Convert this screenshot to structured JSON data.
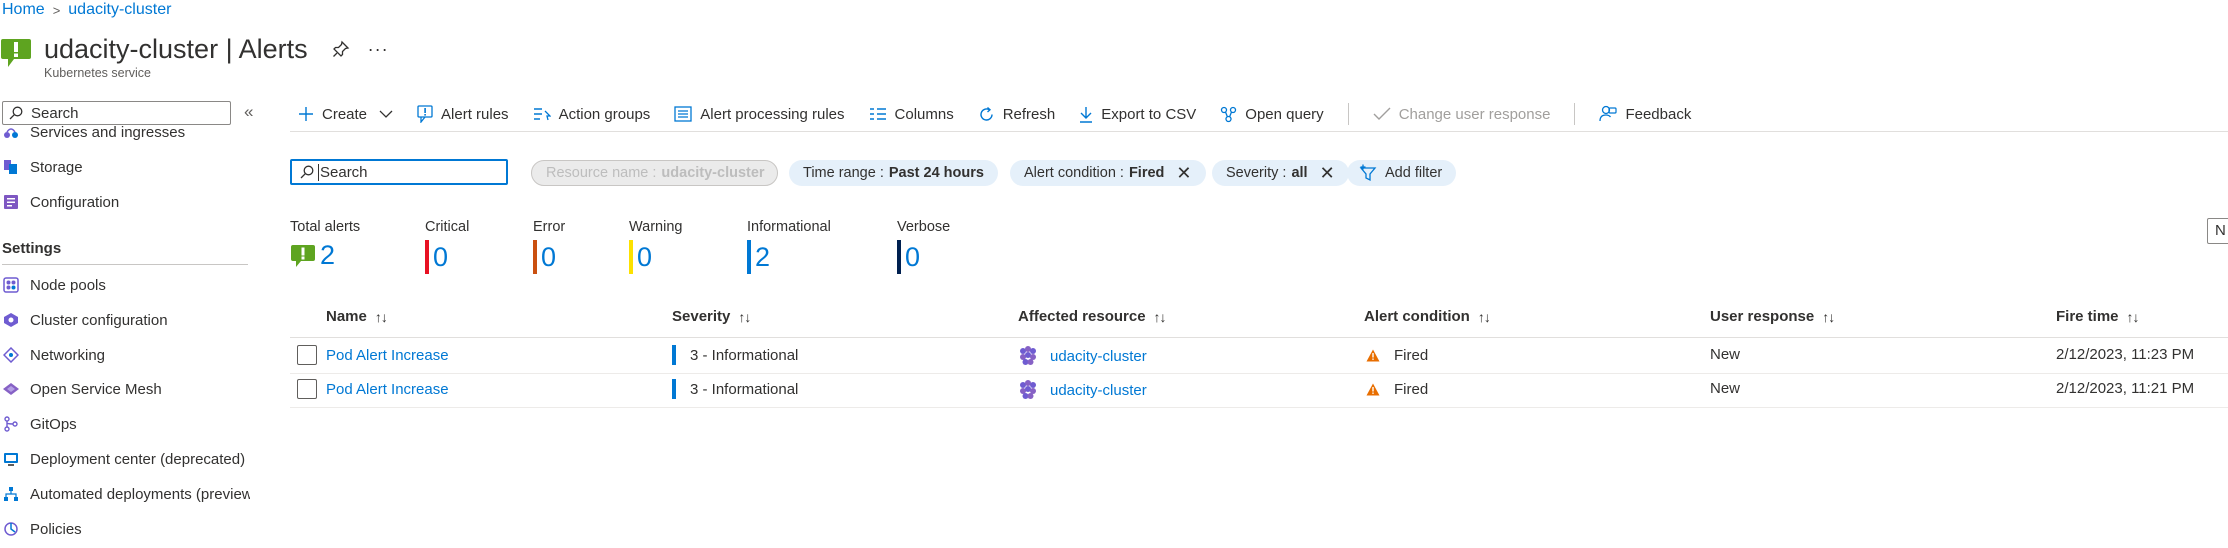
{
  "breadcrumb": {
    "home": "Home",
    "cluster": "udacity-cluster"
  },
  "header": {
    "title_prefix": "udacity-cluster",
    "title_sep": " | ",
    "title_page": "Alerts",
    "subtitle": "Kubernetes service"
  },
  "sidebar": {
    "search_placeholder": "Search",
    "items_top": [
      {
        "label": "Services and ingresses",
        "icon": "services-icon"
      },
      {
        "label": "Storage",
        "icon": "storage-icon"
      },
      {
        "label": "Configuration",
        "icon": "configuration-icon"
      }
    ],
    "settings_label": "Settings",
    "items_settings": [
      {
        "label": "Node pools",
        "icon": "node-pools-icon"
      },
      {
        "label": "Cluster configuration",
        "icon": "cluster-config-icon"
      },
      {
        "label": "Networking",
        "icon": "networking-icon"
      },
      {
        "label": "Open Service Mesh",
        "icon": "service-mesh-icon"
      },
      {
        "label": "GitOps",
        "icon": "gitops-icon"
      },
      {
        "label": "Deployment center (deprecated)",
        "icon": "deployment-center-icon"
      },
      {
        "label": "Automated deployments (preview)",
        "icon": "automated-deployments-icon"
      },
      {
        "label": "Policies",
        "icon": "policies-icon"
      }
    ]
  },
  "toolbar": {
    "create": "Create",
    "alert_rules": "Alert rules",
    "action_groups": "Action groups",
    "alert_processing_rules": "Alert processing rules",
    "columns": "Columns",
    "refresh": "Refresh",
    "export_csv": "Export to CSV",
    "open_query": "Open query",
    "change_user_response": "Change user response",
    "feedback": "Feedback"
  },
  "filters": {
    "search_value": "Search",
    "resource_name_label": "Resource name :",
    "resource_name_value": "udacity-cluster",
    "time_range_label": "Time range :",
    "time_range_value": "Past 24 hours",
    "alert_condition_label": "Alert condition :",
    "alert_condition_value": "Fired",
    "severity_label": "Severity :",
    "severity_value": "all",
    "add_filter": "Add filter"
  },
  "summary": {
    "total_label": "Total alerts",
    "total_value": "2",
    "critical_label": "Critical",
    "critical_value": "0",
    "error_label": "Error",
    "error_value": "0",
    "warning_label": "Warning",
    "warning_value": "0",
    "informational_label": "Informational",
    "informational_value": "2",
    "verbose_label": "Verbose",
    "verbose_value": "0",
    "right_stub": "N"
  },
  "colors": {
    "critical": "#e81123",
    "error": "#ca5010",
    "warning": "#fce100",
    "informational": "#0078d4",
    "verbose": "#002050",
    "accent": "#0078d4"
  },
  "table": {
    "columns": [
      "Name",
      "Severity",
      "Affected resource",
      "Alert condition",
      "User response",
      "Fire time"
    ],
    "sort_glyph": "↑↓",
    "rows": [
      {
        "name": "Pod Alert Increase",
        "severity": "3 - Informational",
        "resource": "udacity-cluster",
        "condition": "Fired",
        "user_response": "New",
        "fire_time": "2/12/2023, 11:23 PM"
      },
      {
        "name": "Pod Alert Increase",
        "severity": "3 - Informational",
        "resource": "udacity-cluster",
        "condition": "Fired",
        "user_response": "New",
        "fire_time": "2/12/2023, 11:21 PM"
      }
    ]
  }
}
